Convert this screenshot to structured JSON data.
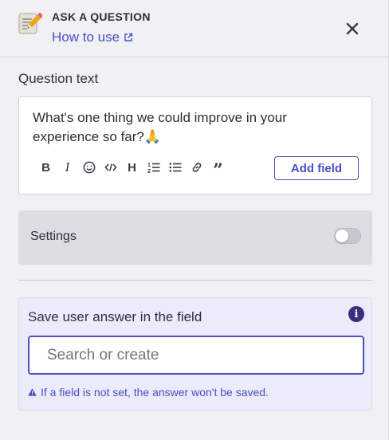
{
  "header": {
    "title": "ASK A QUESTION",
    "help_link": "How to use",
    "icons": {
      "app": "memo-pencil-icon",
      "external": "external-link-icon",
      "close": "close-icon"
    }
  },
  "question": {
    "label": "Question text",
    "text": "What's one thing we could improve in your experience so far?🙏",
    "toolbar": [
      "bold",
      "italic",
      "emoji",
      "code",
      "heading",
      "ordered-list",
      "bullet-list",
      "link",
      "quote"
    ],
    "add_field_label": "Add field"
  },
  "settings": {
    "label": "Settings",
    "enabled": false
  },
  "save_answer": {
    "label": "Save user answer in the field",
    "placeholder": "Search or create",
    "warning": "If a field is not set, the answer won't be saved."
  },
  "colors": {
    "accent": "#4b4fc4",
    "panel_bg": "#f1f1f4",
    "save_box_bg": "#ecebfb",
    "info_icon": "#3b2e7e"
  }
}
